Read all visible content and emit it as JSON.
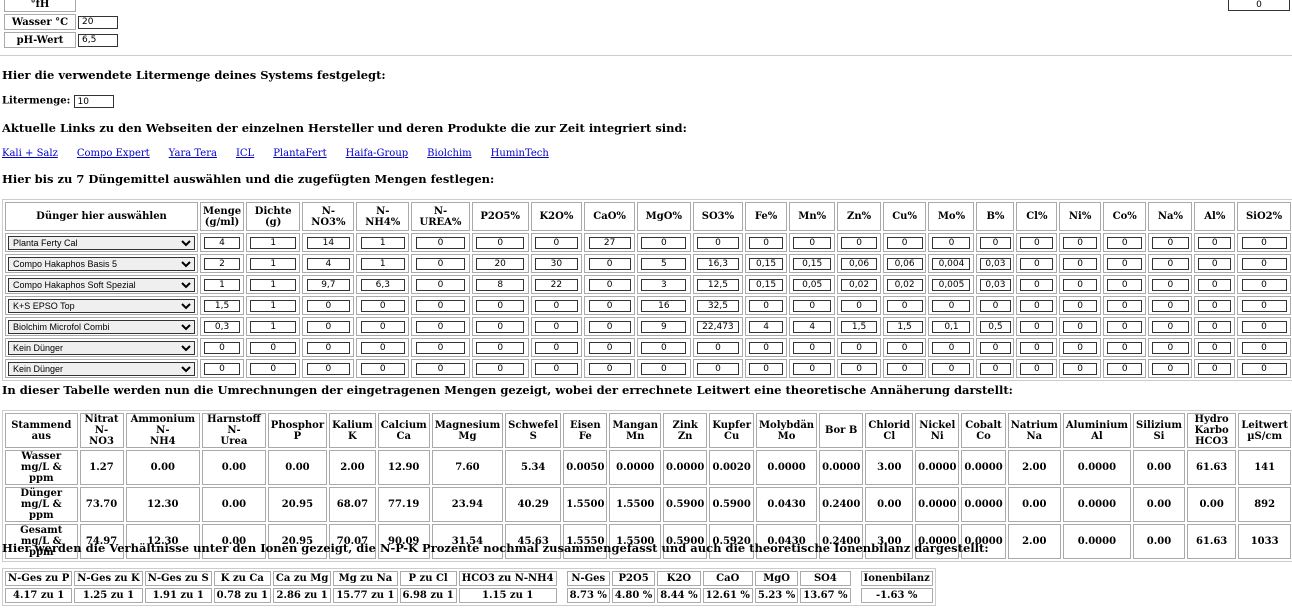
{
  "top": {
    "fh_label": "°fH",
    "water_temp_label": "Wasser °C",
    "water_temp_value": "20",
    "ph_label": "pH-Wert",
    "ph_value": "6,5",
    "right_value": "0"
  },
  "liter": {
    "heading": "Hier die verwendete Litermenge deines Systems festgelegt:",
    "label": "Litermenge:",
    "value": "10"
  },
  "links": {
    "heading": "Aktuelle Links zu den Webseiten der einzelnen Hersteller und deren Produkte die zur Zeit integriert sind:",
    "items": [
      "Kali + Salz",
      "Compo Expert",
      "Yara Tera",
      "ICL",
      "PlantaFert",
      "Haifa-Group",
      "Biolchim",
      "HuminTech"
    ]
  },
  "fertilizer": {
    "heading": "Hier bis zu 7 Düngemittel auswählen und die zugefügten Mengen festlegen:",
    "headers": [
      "Dünger hier auswählen",
      "Menge (g/ml)",
      "Dichte (g)",
      "N-NO3%",
      "N-NH4%",
      "N-UREA%",
      "P2O5%",
      "K2O%",
      "CaO%",
      "MgO%",
      "SO3%",
      "Fe%",
      "Mn%",
      "Zn%",
      "Cu%",
      "Mo%",
      "B%",
      "Cl%",
      "Ni%",
      "Co%",
      "Na%",
      "Al%",
      "SiO2%"
    ],
    "rows": [
      {
        "name": "Planta Ferty Cal",
        "values": [
          "4",
          "1",
          "14",
          "1",
          "0",
          "0",
          "0",
          "27",
          "0",
          "0",
          "0",
          "0",
          "0",
          "0",
          "0",
          "0",
          "0",
          "0",
          "0",
          "0",
          "0",
          "0"
        ]
      },
      {
        "name": "Compo Hakaphos Basis 5",
        "values": [
          "2",
          "1",
          "4",
          "1",
          "0",
          "20",
          "30",
          "0",
          "5",
          "16,3",
          "0,15",
          "0,15",
          "0,06",
          "0,06",
          "0,004",
          "0,03",
          "0",
          "0",
          "0",
          "0",
          "0",
          "0"
        ]
      },
      {
        "name": "Compo Hakaphos Soft Spezial",
        "values": [
          "1",
          "1",
          "9,7",
          "6,3",
          "0",
          "8",
          "22",
          "0",
          "3",
          "12,5",
          "0,15",
          "0,05",
          "0,02",
          "0,02",
          "0,005",
          "0,03",
          "0",
          "0",
          "0",
          "0",
          "0",
          "0"
        ]
      },
      {
        "name": "K+S EPSO Top",
        "values": [
          "1,5",
          "1",
          "0",
          "0",
          "0",
          "0",
          "0",
          "0",
          "16",
          "32,5",
          "0",
          "0",
          "0",
          "0",
          "0",
          "0",
          "0",
          "0",
          "0",
          "0",
          "0",
          "0"
        ]
      },
      {
        "name": "Biolchim Microfol Combi",
        "values": [
          "0,3",
          "1",
          "0",
          "0",
          "0",
          "0",
          "0",
          "0",
          "9",
          "22,473",
          "4",
          "4",
          "1,5",
          "1,5",
          "0,1",
          "0,5",
          "0",
          "0",
          "0",
          "0",
          "0",
          "0"
        ]
      },
      {
        "name": "Kein Dünger",
        "values": [
          "0",
          "0",
          "0",
          "0",
          "0",
          "0",
          "0",
          "0",
          "0",
          "0",
          "0",
          "0",
          "0",
          "0",
          "0",
          "0",
          "0",
          "0",
          "0",
          "0",
          "0",
          "0"
        ]
      },
      {
        "name": "Kein Dünger",
        "values": [
          "0",
          "0",
          "0",
          "0",
          "0",
          "0",
          "0",
          "0",
          "0",
          "0",
          "0",
          "0",
          "0",
          "0",
          "0",
          "0",
          "0",
          "0",
          "0",
          "0",
          "0",
          "0"
        ]
      }
    ]
  },
  "results": {
    "heading": "In dieser Tabelle werden nun die Umrechnungen der eingetragenen Mengen gezeigt, wobei der errechnete Leitwert eine theoretische Annäherung darstellt:",
    "headers": [
      [
        "Stammend aus",
        ""
      ],
      [
        "Nitrat N-",
        "NO3"
      ],
      [
        "Ammonium N-",
        "NH4"
      ],
      [
        "Harnstoff N-",
        "Urea"
      ],
      [
        "Phosphor",
        "P"
      ],
      [
        "Kalium",
        "K"
      ],
      [
        "Calcium",
        "Ca"
      ],
      [
        "Magnesium",
        "Mg"
      ],
      [
        "Schwefel",
        "S"
      ],
      [
        "Eisen",
        "Fe"
      ],
      [
        "Mangan",
        "Mn"
      ],
      [
        "Zink",
        "Zn"
      ],
      [
        "Kupfer",
        "Cu"
      ],
      [
        "Molybdän",
        "Mo"
      ],
      [
        "Bor B",
        ""
      ],
      [
        "Chlorid",
        "Cl"
      ],
      [
        "Nickel",
        "Ni"
      ],
      [
        "Cobalt",
        "Co"
      ],
      [
        "Natrium",
        "Na"
      ],
      [
        "Aluminium",
        "Al"
      ],
      [
        "Silizium",
        "Si"
      ],
      [
        "Hydro Karbo",
        "HCO3"
      ],
      [
        "Leitwert",
        "µS/cm"
      ]
    ],
    "rows": [
      {
        "label": [
          "Wasser mg/L &",
          "ppm"
        ],
        "values": [
          "1.27",
          "0.00",
          "0.00",
          "0.00",
          "2.00",
          "12.90",
          "7.60",
          "5.34",
          "0.0050",
          "0.0000",
          "0.0000",
          "0.0020",
          "0.0000",
          "0.0000",
          "3.00",
          "0.0000",
          "0.0000",
          "2.00",
          "0.0000",
          "0.00",
          "61.63",
          "141"
        ]
      },
      {
        "label": [
          "Dünger mg/L &",
          "ppm"
        ],
        "values": [
          "73.70",
          "12.30",
          "0.00",
          "20.95",
          "68.07",
          "77.19",
          "23.94",
          "40.29",
          "1.5500",
          "1.5500",
          "0.5900",
          "0.5900",
          "0.0430",
          "0.2400",
          "0.00",
          "0.0000",
          "0.0000",
          "0.00",
          "0.0000",
          "0.00",
          "0.00",
          "892"
        ]
      },
      {
        "label": [
          "Gesamt mg/L &",
          "ppm"
        ],
        "values": [
          "74.97",
          "12.30",
          "0.00",
          "20.95",
          "70.07",
          "90.09",
          "31.54",
          "45.63",
          "1.5550",
          "1.5500",
          "0.5900",
          "0.5920",
          "0.0430",
          "0.2400",
          "3.00",
          "0.0000",
          "0.0000",
          "2.00",
          "0.0000",
          "0.00",
          "61.63",
          "1033"
        ]
      }
    ]
  },
  "ratios": {
    "heading": "Hier werden die Verhältnisse unter den Ionen gezeigt, die N-P-K Prozente nochmal zusammengefasst und auch die theoretische Ionenbilanz dargestellt:",
    "ratio_headers": [
      "N-Ges zu P",
      "N-Ges zu K",
      "N-Ges zu S",
      "K zu Ca",
      "Ca zu Mg",
      "Mg zu Na",
      "P zu Cl",
      "HCO3 zu N-NH4"
    ],
    "ratio_values": [
      "4.17 zu 1",
      "1.25 zu 1",
      "1.91 zu 1",
      "0.78 zu 1",
      "2.86 zu 1",
      "15.77 zu 1",
      "6.98 zu 1",
      "1.15 zu 1"
    ],
    "pct_headers": [
      "N-Ges",
      "P2O5",
      "K2O",
      "CaO",
      "MgO",
      "SO4"
    ],
    "pct_values": [
      "8.73 %",
      "4.80 %",
      "8.44 %",
      "12.61 %",
      "5.23 %",
      "13.67 %"
    ],
    "balance_header": "Ionenbilanz",
    "balance_value": "-1.63 %"
  }
}
